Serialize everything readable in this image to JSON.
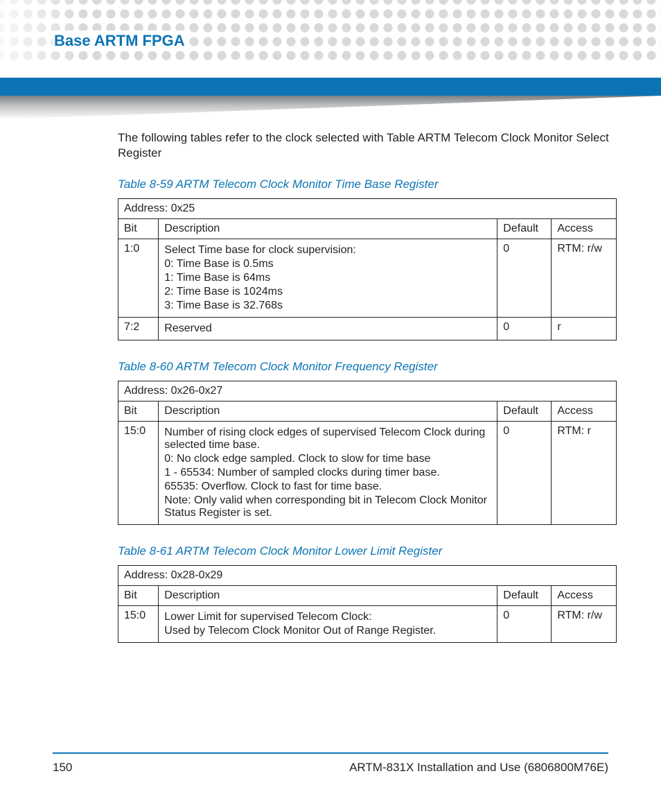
{
  "header": {
    "title": "Base ARTM FPGA"
  },
  "intro": "The following tables refer to the clock selected with Table ARTM Telecom Clock Monitor Select Register",
  "col_labels": {
    "bit": "Bit",
    "desc": "Description",
    "def": "Default",
    "acc": "Access"
  },
  "tables": [
    {
      "caption": "Table 8-59 ARTM Telecom Clock Monitor Time Base Register",
      "address": "Address: 0x25",
      "rows": [
        {
          "bit": "1:0",
          "desc_lines": [
            "Select Time base for clock supervision:",
            "0: Time Base is 0.5ms",
            "1: Time Base is 64ms",
            "2: Time Base is 1024ms",
            "3: Time Base is 32.768s"
          ],
          "default": "0",
          "access": "RTM: r/w"
        },
        {
          "bit": "7:2",
          "desc_lines": [
            "Reserved"
          ],
          "default": "0",
          "access": "r"
        }
      ]
    },
    {
      "caption": "Table 8-60 ARTM Telecom Clock Monitor Frequency Register",
      "address": "Address: 0x26-0x27",
      "rows": [
        {
          "bit": "15:0",
          "desc_lines": [
            "Number of rising clock edges of supervised Telecom Clock during selected time base.",
            "0: No clock edge sampled. Clock to slow for time base",
            "1 - 65534: Number of sampled clocks during timer base.",
            "65535: Overflow. Clock to fast for time base.",
            "Note: Only valid when corresponding bit in Telecom Clock Monitor Status Register is set."
          ],
          "default": "0",
          "access": "RTM: r"
        }
      ]
    },
    {
      "caption": "Table 8-61 ARTM Telecom Clock Monitor Lower Limit Register",
      "address": "Address: 0x28-0x29",
      "rows": [
        {
          "bit": "15:0",
          "desc_lines": [
            "Lower Limit for supervised Telecom Clock:",
            "Used by Telecom Clock Monitor Out of Range Register."
          ],
          "default": "0",
          "access": "RTM: r/w"
        }
      ]
    }
  ],
  "footer": {
    "page": "150",
    "doc": "ARTM-831X Installation and Use (6806800M76E)"
  }
}
